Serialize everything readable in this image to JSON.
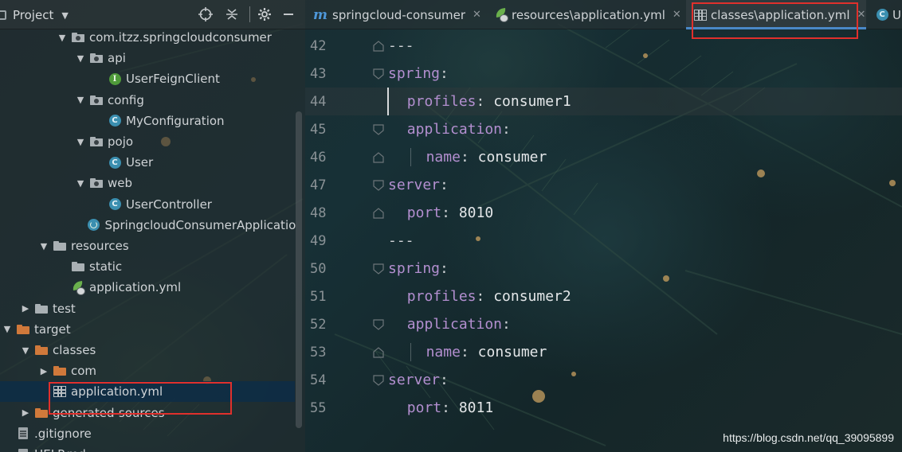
{
  "project_panel": {
    "title": "Project",
    "tree": [
      {
        "label": "com.itzz.springcloudconsumer",
        "icon": "package-icon",
        "indent": 4,
        "expanded": true
      },
      {
        "label": "api",
        "icon": "package-icon",
        "indent": 5,
        "expanded": true
      },
      {
        "label": "UserFeignClient",
        "icon": "interface-icon",
        "indent": 6
      },
      {
        "label": "config",
        "icon": "package-icon",
        "indent": 5,
        "expanded": true
      },
      {
        "label": "MyConfiguration",
        "icon": "class-icon",
        "indent": 6
      },
      {
        "label": "pojo",
        "icon": "package-icon",
        "indent": 5,
        "expanded": true
      },
      {
        "label": "User",
        "icon": "class-icon",
        "indent": 6
      },
      {
        "label": "web",
        "icon": "package-icon",
        "indent": 5,
        "expanded": true
      },
      {
        "label": "UserController",
        "icon": "class-icon",
        "indent": 6
      },
      {
        "label": "SpringcloudConsumerApplicatio",
        "icon": "spring-boot-class-icon",
        "indent": 5
      },
      {
        "label": "resources",
        "icon": "resources-folder-icon",
        "indent": 3,
        "expanded": true
      },
      {
        "label": "static",
        "icon": "folder-icon",
        "indent": 4
      },
      {
        "label": "application.yml",
        "icon": "spring-yaml-icon",
        "indent": 4
      },
      {
        "label": "test",
        "icon": "folder-icon",
        "indent": 2,
        "expanded": false
      },
      {
        "label": "target",
        "icon": "orange-folder-icon",
        "indent": 1,
        "expanded": true
      },
      {
        "label": "classes",
        "icon": "orange-folder-icon",
        "indent": 2,
        "expanded": true
      },
      {
        "label": "com",
        "icon": "orange-folder-icon",
        "indent": 3,
        "expanded": false
      },
      {
        "label": "application.yml",
        "icon": "yaml-table-icon",
        "indent": 3,
        "selected": true
      },
      {
        "label": "generated-sources",
        "icon": "orange-folder-icon",
        "indent": 2,
        "expanded": false
      },
      {
        "label": ".gitignore",
        "icon": "file-icon",
        "indent": 1
      },
      {
        "label": "HELP.md",
        "icon": "file-icon",
        "indent": 1
      }
    ]
  },
  "tabs": [
    {
      "label": "springcloud-consumer",
      "icon": "maven-icon",
      "active": false
    },
    {
      "label": "resources\\application.yml",
      "icon": "spring-yaml-icon",
      "active": false
    },
    {
      "label": "classes\\application.yml",
      "icon": "yaml-table-icon",
      "active": true
    },
    {
      "label": "U",
      "icon": "class-icon",
      "active": false
    }
  ],
  "code_lines": [
    {
      "num": "42",
      "key": "---",
      "sep": "",
      "value": "",
      "indent": 0
    },
    {
      "num": "43",
      "key": "spring",
      "sep": ":",
      "value": "",
      "indent": 0
    },
    {
      "num": "44",
      "key": "profiles",
      "sep": ": ",
      "value": "consumer1",
      "indent": 1,
      "current": true
    },
    {
      "num": "45",
      "key": "application",
      "sep": ":",
      "value": "",
      "indent": 1
    },
    {
      "num": "46",
      "key": "name",
      "sep": ": ",
      "value": "consumer",
      "indent": 2
    },
    {
      "num": "47",
      "key": "server",
      "sep": ":",
      "value": "",
      "indent": 0
    },
    {
      "num": "48",
      "key": "port",
      "sep": ": ",
      "value": "8010",
      "indent": 1
    },
    {
      "num": "49",
      "key": "---",
      "sep": "",
      "value": "",
      "indent": 1
    },
    {
      "num": "50",
      "key": "spring",
      "sep": ":",
      "value": "",
      "indent": 0
    },
    {
      "num": "51",
      "key": "profiles",
      "sep": ": ",
      "value": "consumer2",
      "indent": 1
    },
    {
      "num": "52",
      "key": "application",
      "sep": ":",
      "value": "",
      "indent": 1
    },
    {
      "num": "53",
      "key": "name",
      "sep": ": ",
      "value": "consumer",
      "indent": 2
    },
    {
      "num": "54",
      "key": "server",
      "sep": ":",
      "value": "",
      "indent": 0
    },
    {
      "num": "55",
      "key": "port",
      "sep": ": ",
      "value": "8011",
      "indent": 1
    }
  ],
  "watermark": "https://blog.csdn.net/qq_39095899",
  "colors": {
    "yaml_key": "#b38fd0",
    "highlight_box": "#e0302c",
    "active_tab_underline": "#4a88c7",
    "selection": "#0d2d46"
  }
}
